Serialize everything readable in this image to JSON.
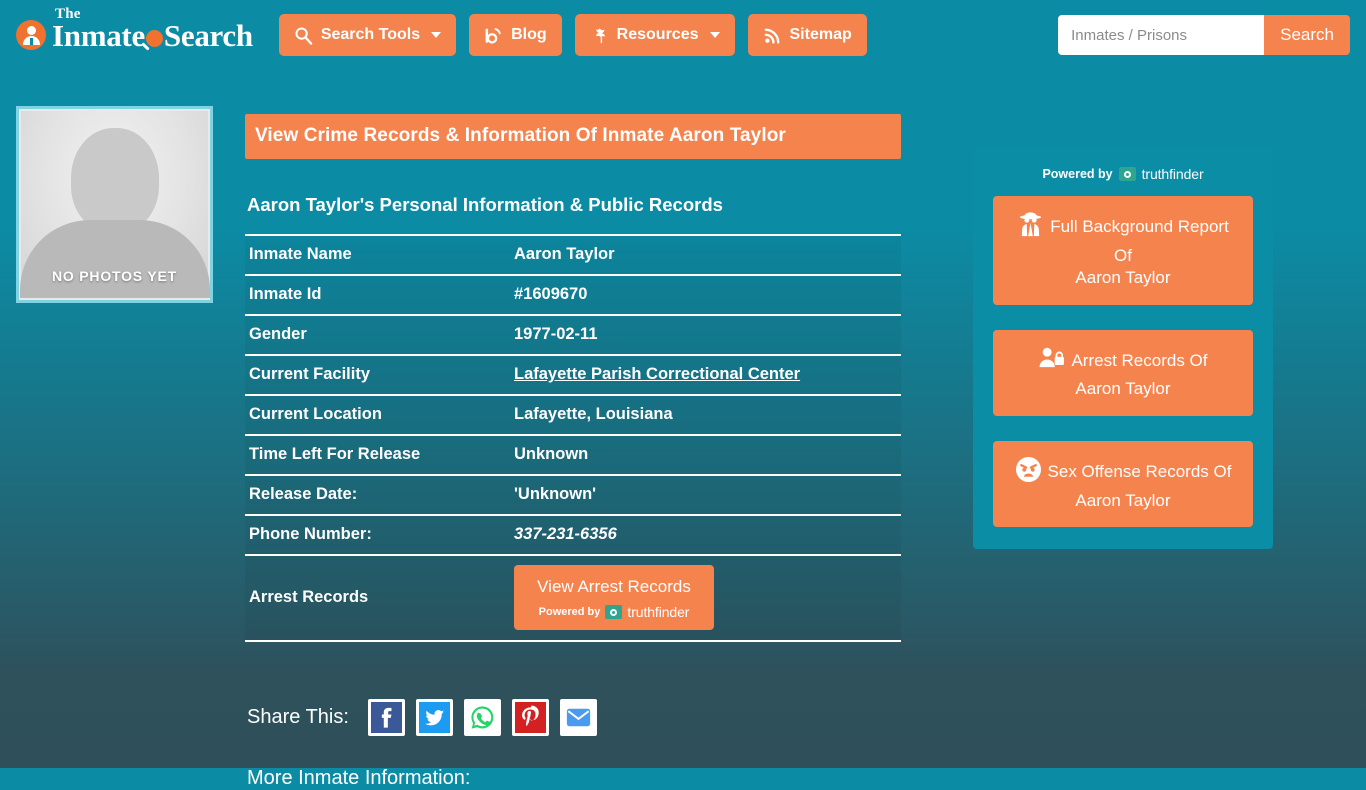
{
  "brand": {
    "the": "The",
    "name_part1": "Inmate",
    "name_part2": "Search",
    "logo_icon": "inmate-avatar-icon",
    "magnifier_icon": "magnifier-icon"
  },
  "nav": {
    "items": [
      {
        "label": "Search Tools",
        "icon": "magnifier-icon",
        "has_caret": true
      },
      {
        "label": "Blog",
        "icon": "blogger-icon",
        "has_caret": false
      },
      {
        "label": "Resources",
        "icon": "leaf-icon",
        "has_caret": true
      },
      {
        "label": "Sitemap",
        "icon": "rss-icon",
        "has_caret": false
      }
    ]
  },
  "search": {
    "placeholder": "Inmates / Prisons",
    "value": "",
    "button_label": "Search"
  },
  "photo": {
    "caption": "NO PHOTOS YET",
    "alt": "inmate-photo-placeholder"
  },
  "main": {
    "title": "View Crime Records & Information Of Inmate Aaron Taylor",
    "subtitle": "Aaron Taylor's Personal Information & Public Records",
    "rows": [
      {
        "label": "Inmate Name",
        "value": "Aaron Taylor",
        "style": "bold"
      },
      {
        "label": "Inmate Id",
        "value": "#1609670",
        "style": "bold"
      },
      {
        "label": "Gender",
        "value": "1977-02-11",
        "style": "bold"
      },
      {
        "label": "Current Facility",
        "value": "Lafayette Parish Correctional Center",
        "style": "link"
      },
      {
        "label": "Current Location",
        "value": "Lafayette, Louisiana",
        "style": "bold"
      },
      {
        "label": "Time Left For Release",
        "value": "Unknown",
        "style": "bold"
      },
      {
        "label": "Release Date:",
        "value": "'Unknown'",
        "style": "plain"
      },
      {
        "label": "Phone Number:",
        "value": "337-231-6356",
        "style": "italic"
      }
    ],
    "arrest_row": {
      "label": "Arrest Records",
      "button_label": "View Arrest Records",
      "powered_by": "Powered by",
      "provider": "truthfinder"
    }
  },
  "share": {
    "label": "Share This:",
    "icons": [
      {
        "name": "facebook-icon",
        "color": "#3b5998"
      },
      {
        "name": "twitter-icon",
        "color": "#1d9bf0"
      },
      {
        "name": "whatsapp-icon",
        "color": "#25d366"
      },
      {
        "name": "pinterest-icon",
        "color": "#d32121"
      },
      {
        "name": "email-icon",
        "color": "#4a9af0"
      }
    ]
  },
  "more_info_heading": "More Inmate Information:",
  "sidebar": {
    "powered_by": "Powered by",
    "provider": "truthfinder",
    "buttons": [
      {
        "icon": "detective-icon",
        "line1": "Full Background Report",
        "line2": "Of",
        "line3": "Aaron Taylor"
      },
      {
        "icon": "person-lock-icon",
        "line1": "Arrest Records Of",
        "line2": "Aaron Taylor",
        "line3": ""
      },
      {
        "icon": "angry-face-icon",
        "line1": "Sex Offense Records Of",
        "line2": "Aaron Taylor",
        "line3": ""
      }
    ]
  },
  "colors": {
    "accent_orange": "#f5834e",
    "bg_top_teal": "#0c8ba4",
    "bg_bottom_slate": "#2f5059",
    "panel_teal": "#0b8da6",
    "photo_border": "#7fd3e2"
  }
}
